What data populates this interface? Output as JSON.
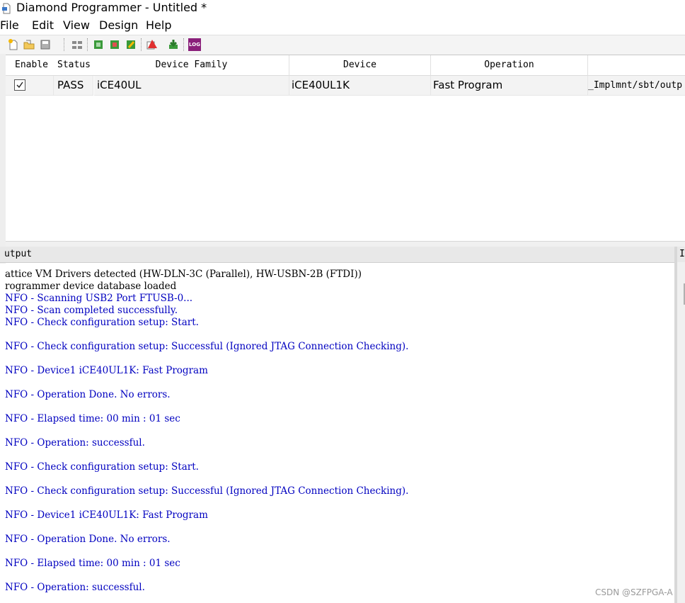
{
  "window": {
    "title": "Diamond Programmer - Untitled *"
  },
  "menu": [
    "File",
    "Edit",
    "View",
    "Design",
    "Help"
  ],
  "toolbar": {
    "icons": [
      "new-file-icon",
      "open-file-icon",
      "save-icon",
      "scan-icon",
      "cable-settings-icon",
      "program-device-icon",
      "edit-device-icon",
      "device-properties-icon",
      "download-icon",
      "log-icon"
    ],
    "log_label": "LOG"
  },
  "grid": {
    "columns": [
      "Enable",
      "Status",
      "Device Family",
      "Device",
      "Operation",
      ""
    ],
    "rows": [
      {
        "enabled": true,
        "status": "PASS",
        "family": "iCE40UL",
        "device": "iCE40UL1K",
        "operation": "Fast Program",
        "file": "_Implmnt/sbt/outp"
      }
    ]
  },
  "output": {
    "title": "utput",
    "lines": [
      {
        "text": "attice VM Drivers detected (HW-DLN-3C (Parallel), HW-USBN-2B (FTDI))",
        "kind": "plain"
      },
      {
        "text": "rogrammer device database loaded",
        "kind": "plain"
      },
      {
        "text": "NFO - Scanning USB2 Port FTUSB-0...",
        "kind": "info"
      },
      {
        "text": "NFO - Scan completed successfully.",
        "kind": "info"
      },
      {
        "text": "NFO - Check configuration setup: Start.",
        "kind": "info"
      },
      {
        "text": "",
        "kind": "info"
      },
      {
        "text": "NFO - Check configuration setup: Successful (Ignored JTAG Connection Checking).",
        "kind": "info"
      },
      {
        "text": "",
        "kind": "info"
      },
      {
        "text": "NFO - Device1 iCE40UL1K: Fast Program",
        "kind": "info"
      },
      {
        "text": "",
        "kind": "info"
      },
      {
        "text": "NFO - Operation Done. No errors.",
        "kind": "info"
      },
      {
        "text": "",
        "kind": "info"
      },
      {
        "text": "NFO - Elapsed time: 00 min : 01 sec",
        "kind": "info"
      },
      {
        "text": "",
        "kind": "info"
      },
      {
        "text": "NFO - Operation: successful.",
        "kind": "info"
      },
      {
        "text": "",
        "kind": "info"
      },
      {
        "text": "NFO - Check configuration setup: Start.",
        "kind": "info"
      },
      {
        "text": "",
        "kind": "info"
      },
      {
        "text": "NFO - Check configuration setup: Successful (Ignored JTAG Connection Checking).",
        "kind": "info"
      },
      {
        "text": "",
        "kind": "info"
      },
      {
        "text": "NFO - Device1 iCE40UL1K: Fast Program",
        "kind": "info"
      },
      {
        "text": "",
        "kind": "info"
      },
      {
        "text": "NFO - Operation Done. No errors.",
        "kind": "info"
      },
      {
        "text": "",
        "kind": "info"
      },
      {
        "text": "NFO - Elapsed time: 00 min : 01 sec",
        "kind": "info"
      },
      {
        "text": "",
        "kind": "info"
      },
      {
        "text": "NFO - Operation: successful.",
        "kind": "info"
      }
    ]
  },
  "right_panel": {
    "title": "I"
  },
  "watermark": "CSDN @SZFPGA-A",
  "colors": {
    "info_text": "#0000c0",
    "plain_text": "#000000"
  }
}
